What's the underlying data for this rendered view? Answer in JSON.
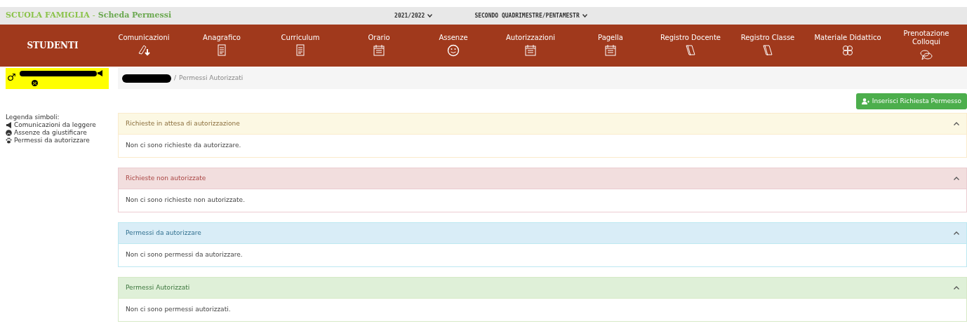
{
  "header": {
    "app_title": "SCUOLA FAMIGLIA",
    "separator": "-",
    "page_title": "Scheda Permessi",
    "year_select": "2021/2022",
    "period_select": "SECONDO QUADRIMESTRE/PENTAMESTR"
  },
  "nav": {
    "brand": "STUDENTI",
    "items": [
      {
        "label": "Comunicazioni"
      },
      {
        "label": "Anagrafico"
      },
      {
        "label": "Curriculum"
      },
      {
        "label": "Orario"
      },
      {
        "label": "Assenze"
      },
      {
        "label": "Autorizzazioni"
      },
      {
        "label": "Pagella"
      },
      {
        "label": "Registro Docente"
      },
      {
        "label": "Registro Classe"
      },
      {
        "label": "Materiale Didattico"
      },
      {
        "label": "Prenotazione Colloqui"
      }
    ]
  },
  "student": {
    "gender_symbol": "♂"
  },
  "breadcrumb": {
    "separator": "/",
    "current": "Permessi Autorizzati"
  },
  "legend": {
    "title": "Legenda simboli:",
    "items": [
      {
        "label": "Comunicazioni da leggere"
      },
      {
        "label": "Assenze da giustificare"
      },
      {
        "label": "Permessi da autorizzare"
      }
    ]
  },
  "add_button": "Inserisci Richiesta Permesso",
  "panels": [
    {
      "kind": "warning",
      "title": "Richieste in attesa di autorizzazione",
      "body": "Non ci sono richieste da autorizzare.",
      "expanded": true
    },
    {
      "kind": "danger",
      "title": "Richieste non autorizzate",
      "body": "Non ci sono richieste non autorizzate.",
      "expanded": true
    },
    {
      "kind": "info",
      "title": "Permessi da autorizzare",
      "body": "Non ci sono permessi da autorizzare.",
      "expanded": true
    },
    {
      "kind": "success",
      "title": "Permessi Autorizzati",
      "body": "Non ci sono permessi autorizzati.",
      "expanded": true
    }
  ]
}
